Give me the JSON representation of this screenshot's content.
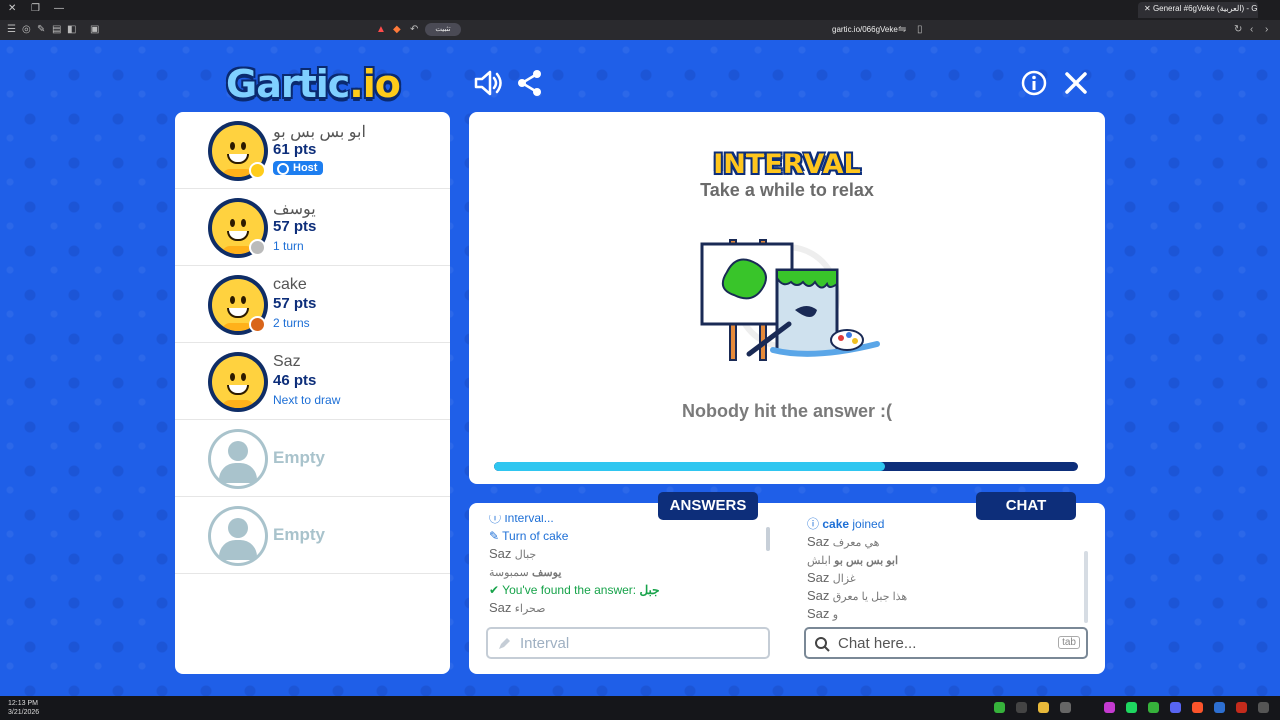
{
  "browser": {
    "tab_title": "General #6gVeke (العربية) - G",
    "url": "gartic.io/066gVeke",
    "install_label": "تثبيت"
  },
  "header": {
    "logo_text": "Gartic",
    "logo_suffix": ".io"
  },
  "players": [
    {
      "name": "ابو بس بس بو",
      "points": "61 pts",
      "sub": "",
      "badge": "Host",
      "dot_color": "#ffcc1a"
    },
    {
      "name": "يوسف",
      "points": "57 pts",
      "sub": "1 turn",
      "badge": "",
      "dot_color": "#bbbbbb"
    },
    {
      "name": "cake",
      "points": "57 pts",
      "sub": "2 turns",
      "badge": "",
      "dot_color": "#d9651a"
    },
    {
      "name": "Saz",
      "points": "46 pts",
      "sub": "Next to draw",
      "badge": "",
      "dot_color": ""
    }
  ],
  "empty_slots": [
    "Empty",
    "Empty"
  ],
  "stage": {
    "title": "INTERVAL",
    "subtitle": "Take a while to relax",
    "result": "Nobody hit the answer :(",
    "progress": 0.67
  },
  "answers": {
    "tab_label": "ANSWERS",
    "messages": [
      {
        "kind": "info",
        "text": "Interval..."
      },
      {
        "kind": "turn",
        "text": "Turn of ",
        "name": "cake"
      },
      {
        "kind": "guess",
        "who": "Saz",
        "text": "جبال"
      },
      {
        "kind": "guess",
        "who": "يوسف",
        "text": "سمبوسة"
      },
      {
        "kind": "found",
        "text": "You've found the answer: ",
        "answer": "جبل"
      },
      {
        "kind": "guess",
        "who": "Saz",
        "text": "صحراء"
      }
    ],
    "input_placeholder": "Interval"
  },
  "chat": {
    "tab_label": "CHAT",
    "messages": [
      {
        "kind": "join",
        "name": "cake",
        "text": " joined"
      },
      {
        "who": "Saz",
        "text": "هي معرف"
      },
      {
        "who": "ابو بس بس بو",
        "text": "ابلش"
      },
      {
        "who": "Saz",
        "text": "غزال"
      },
      {
        "who": "Saz",
        "text": "هذا جبل يا معرق"
      },
      {
        "who": "Saz",
        "text": "و"
      }
    ],
    "input_placeholder": "Chat here...",
    "tab_key": "tab"
  },
  "taskbar": {
    "time": "12:13 PM",
    "date": "3/21/2026"
  },
  "colors": {
    "background": "#1f5fe8",
    "navy": "#0d2e7a",
    "link_blue": "#1d6fd6",
    "progress": "#2fc6f0",
    "found_green": "#17a34a"
  }
}
